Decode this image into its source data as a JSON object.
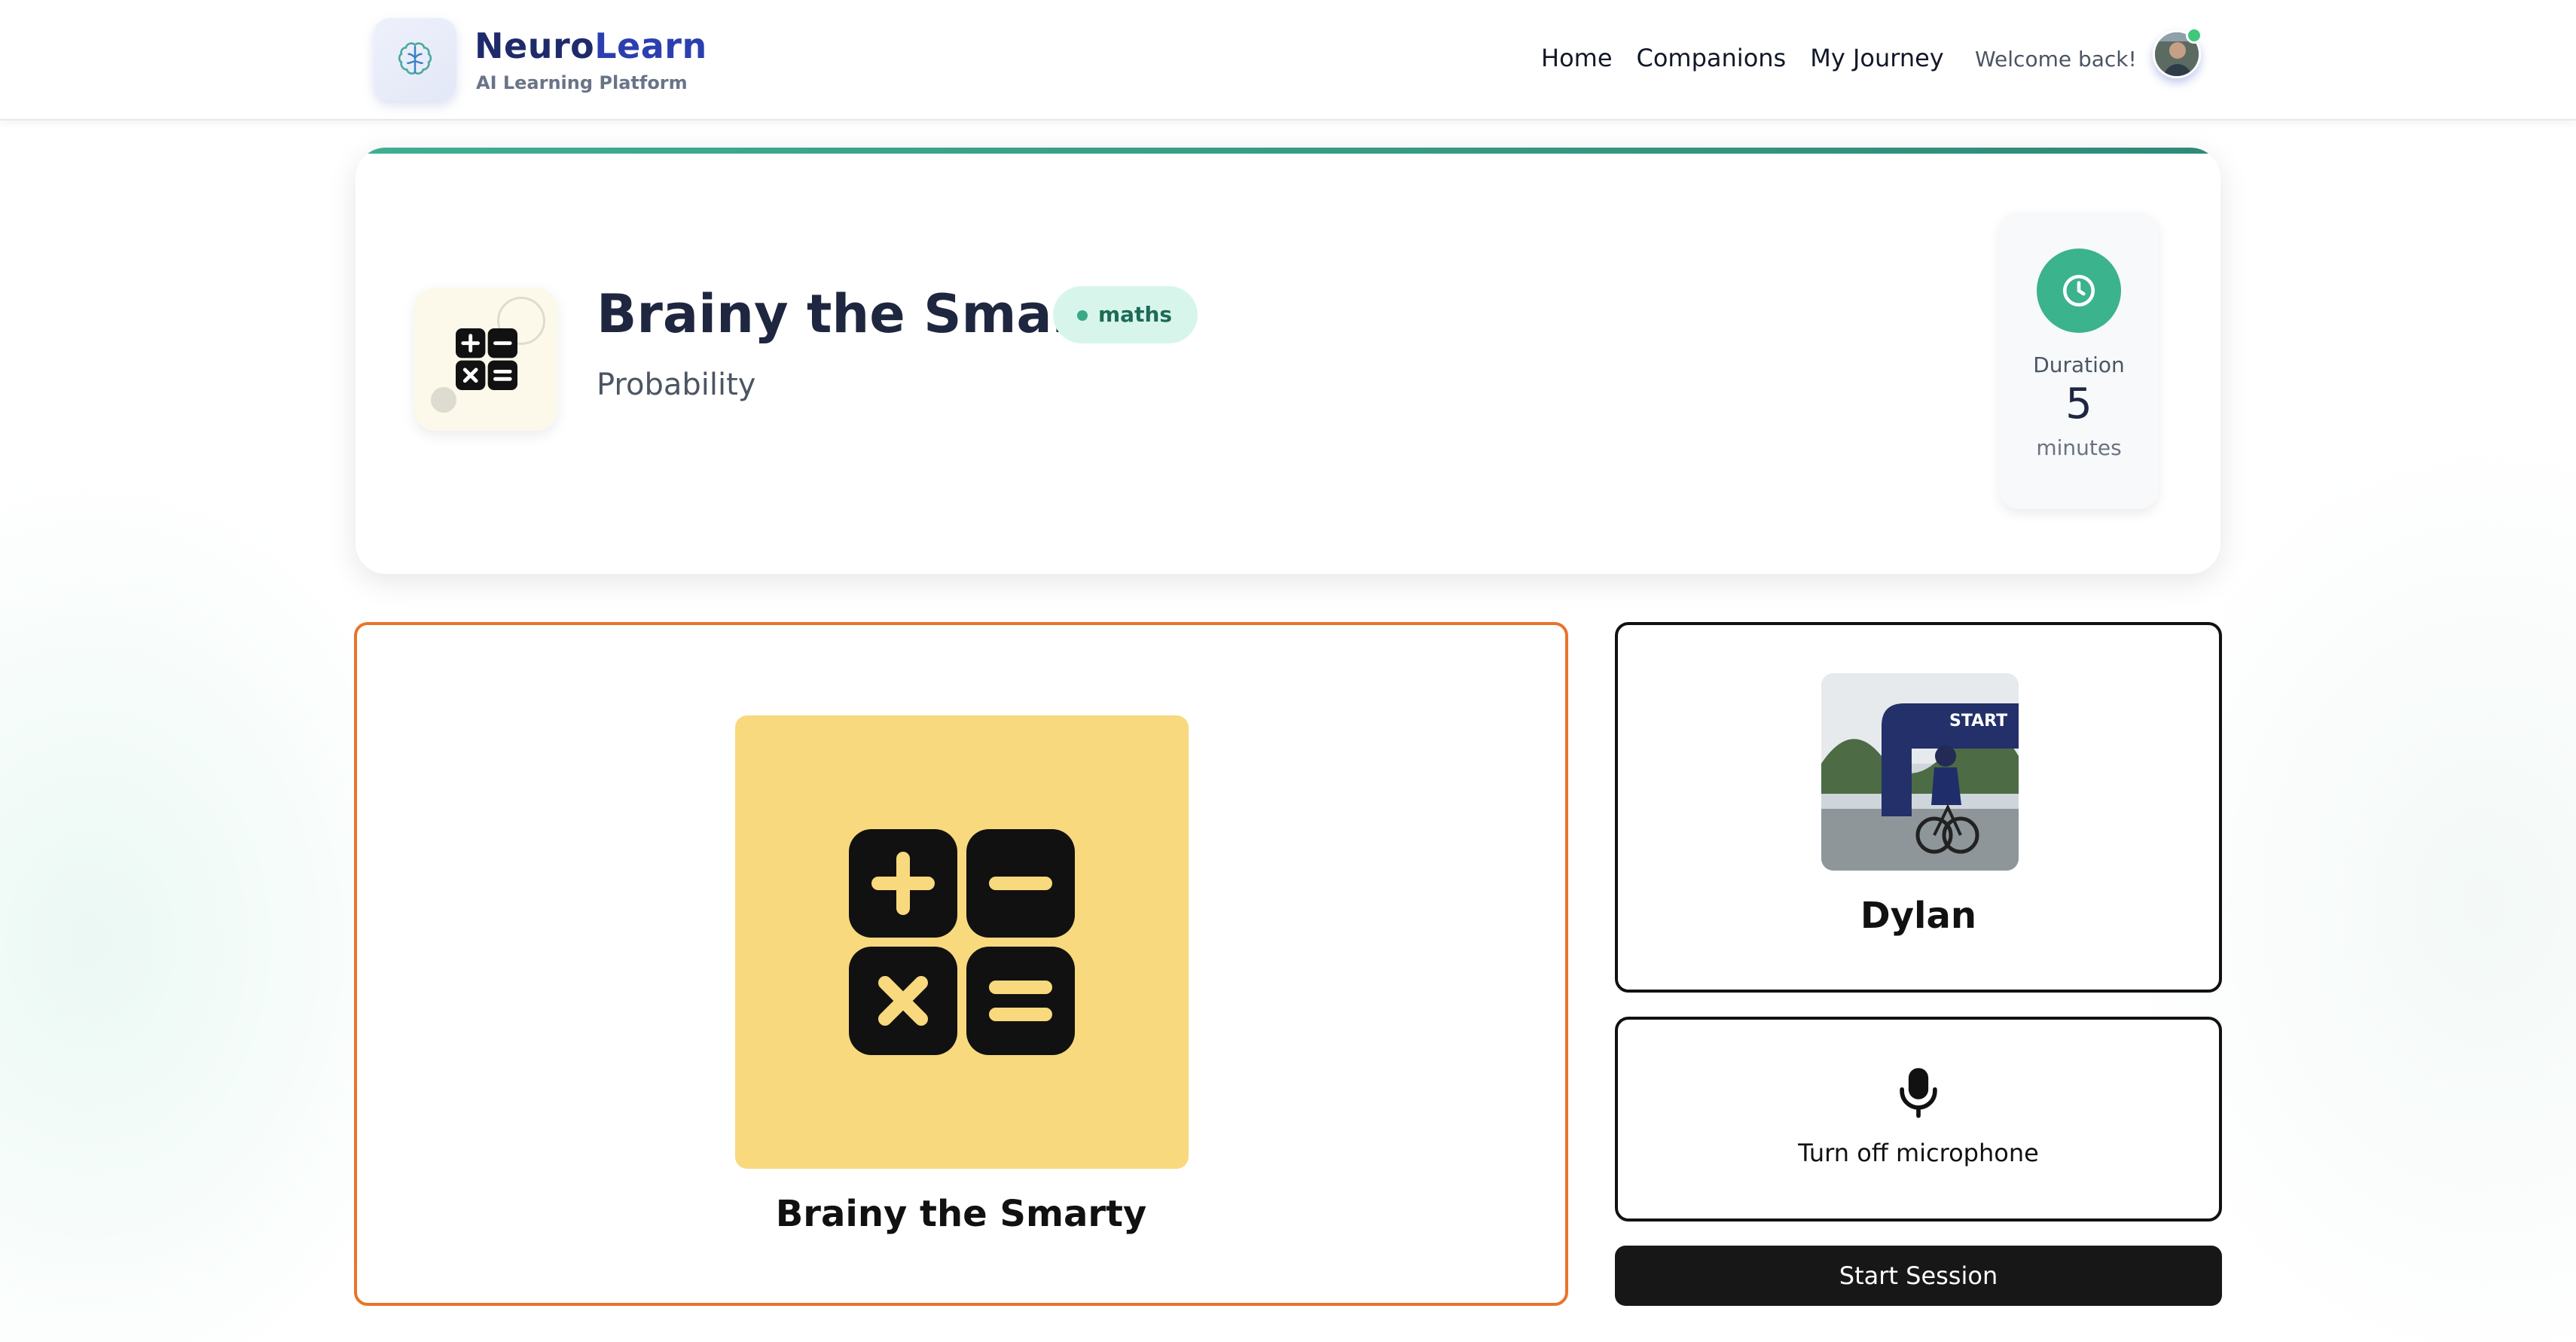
{
  "brand": {
    "name_part1": "Neuro",
    "name_part2": "Learn",
    "tagline": "AI Learning Platform",
    "logo_icon": "brain-icon"
  },
  "nav": {
    "links": [
      "Home",
      "Companions",
      "My Journey"
    ],
    "welcome": "Welcome back!",
    "avatar_status": "online"
  },
  "session": {
    "companion_name": "Brainy the Smarty",
    "subject": "maths",
    "topic": "Probability",
    "duration_label": "Duration",
    "duration_value": "5",
    "duration_unit": "minutes",
    "subject_icon": "calculator-icon"
  },
  "user": {
    "name": "Dylan"
  },
  "controls": {
    "mic_label": "Turn off microphone",
    "start_label": "Start Session"
  },
  "colors": {
    "accent_green": "#3bb38d",
    "companion_border": "#e8742b",
    "companion_tile": "#f8d97d",
    "brand_blue": "#1f2a6b"
  }
}
